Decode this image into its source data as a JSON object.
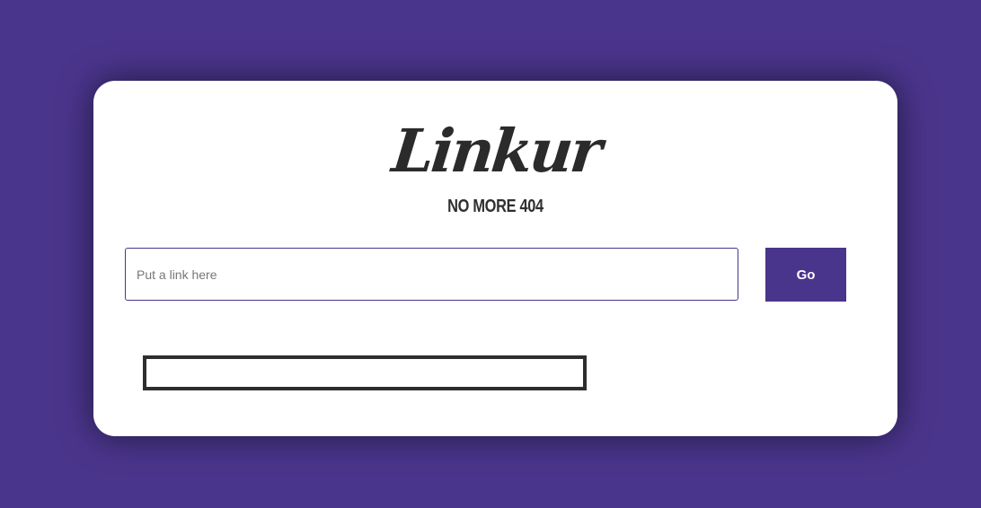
{
  "brand": {
    "logo_text": "Linkur",
    "tagline": "NO MORE 404"
  },
  "form": {
    "input_placeholder": "Put a link here",
    "input_value": "",
    "submit_label": "Go"
  },
  "result": {
    "text": ""
  },
  "colors": {
    "background": "#4a358c",
    "card": "#ffffff",
    "accent": "#4a358c",
    "text_dark": "#2b2b2b"
  }
}
